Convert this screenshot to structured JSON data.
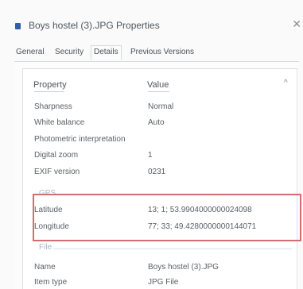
{
  "window": {
    "title": "Boys hostel (3).JPG Properties",
    "close_icon": "close-icon"
  },
  "tabs": [
    {
      "label": "General",
      "active": false
    },
    {
      "label": "Security",
      "active": false
    },
    {
      "label": "Details",
      "active": true
    },
    {
      "label": "Previous Versions",
      "active": false
    }
  ],
  "table": {
    "column_property": "Property",
    "column_value": "Value",
    "rows_top": [
      {
        "name": "Sharpness",
        "value": "Normal"
      },
      {
        "name": "White balance",
        "value": "Auto"
      },
      {
        "name": "Photometric interpretation",
        "value": ""
      },
      {
        "name": "Digital zoom",
        "value": "1"
      },
      {
        "name": "EXIF version",
        "value": "0231"
      }
    ],
    "gps_group": "GPS",
    "gps_rows": [
      {
        "name": "Latitude",
        "value": "13; 1; 53.9904000000024098"
      },
      {
        "name": "Longitude",
        "value": "77; 33; 49.4280000000144071"
      }
    ],
    "file_group": "File",
    "file_rows": [
      {
        "name": "Name",
        "value": "Boys hostel (3).JPG"
      },
      {
        "name": "Item type",
        "value": "JPG File"
      }
    ]
  },
  "colors": {
    "highlight_border": "#d26d70",
    "group_label": "#a9b9cc",
    "title_icon": "#2f5fa8"
  }
}
